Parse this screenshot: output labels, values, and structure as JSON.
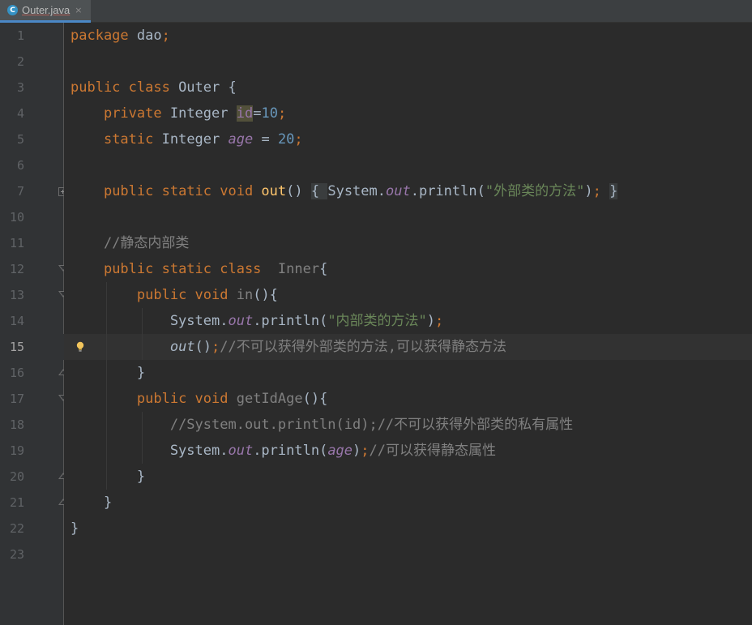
{
  "tab": {
    "icon_letter": "C",
    "label": "Outer.java",
    "close": "×"
  },
  "current_line": "15",
  "lines": [
    {
      "num": "1",
      "segments": [
        [
          "kw",
          "package "
        ],
        [
          "pl",
          "dao"
        ],
        [
          "kw",
          ";"
        ]
      ]
    },
    {
      "num": "2",
      "segments": []
    },
    {
      "num": "3",
      "segments": [
        [
          "kw",
          "public class "
        ],
        [
          "pl",
          "Outer {"
        ]
      ]
    },
    {
      "num": "4",
      "segments": [
        [
          "pl",
          "    "
        ],
        [
          "kw",
          "private "
        ],
        [
          "pl",
          "Integer "
        ],
        [
          "field",
          "id"
        ],
        [
          "pl",
          "="
        ],
        [
          "num",
          "10"
        ],
        [
          "kw",
          ";"
        ]
      ]
    },
    {
      "num": "5",
      "segments": [
        [
          "pl",
          "    "
        ],
        [
          "kw",
          "static "
        ],
        [
          "pl",
          "Integer "
        ],
        [
          "ifield",
          "age"
        ],
        [
          "pl",
          " = "
        ],
        [
          "num",
          "20"
        ],
        [
          "kw",
          ";"
        ]
      ]
    },
    {
      "num": "6",
      "segments": []
    },
    {
      "num": "7",
      "segments": [
        [
          "pl",
          "    "
        ],
        [
          "kw",
          "public static void "
        ],
        [
          "fn",
          "out"
        ],
        [
          "pl",
          "() "
        ],
        [
          "fold",
          "{ "
        ],
        [
          "pl",
          "System."
        ],
        [
          "ifield",
          "out"
        ],
        [
          "pl",
          ".println("
        ],
        [
          "str",
          "\"外部类的方法\""
        ],
        [
          "pl",
          ")"
        ],
        [
          "kw",
          ";"
        ],
        [
          "pl",
          " "
        ],
        [
          "fold",
          "}"
        ]
      ]
    },
    {
      "num": "10",
      "segments": []
    },
    {
      "num": "11",
      "segments": [
        [
          "pl",
          "    "
        ],
        [
          "cmt",
          "//静态内部类"
        ]
      ]
    },
    {
      "num": "12",
      "segments": [
        [
          "pl",
          "    "
        ],
        [
          "kw",
          "public static class  "
        ],
        [
          "gray",
          "Inner"
        ],
        [
          "pl",
          "{"
        ]
      ]
    },
    {
      "num": "13",
      "segments": [
        [
          "pl",
          "        "
        ],
        [
          "kw",
          "public void "
        ],
        [
          "gray",
          "in"
        ],
        [
          "pl",
          "(){"
        ]
      ]
    },
    {
      "num": "14",
      "segments": [
        [
          "pl",
          "            System."
        ],
        [
          "ifield",
          "out"
        ],
        [
          "pl",
          ".println("
        ],
        [
          "str",
          "\"内部类的方法\""
        ],
        [
          "pl",
          ")"
        ],
        [
          "kw",
          ";"
        ]
      ]
    },
    {
      "num": "15",
      "segments": [
        [
          "pl",
          "            "
        ],
        [
          "sstat",
          "out"
        ],
        [
          "pl",
          "()"
        ],
        [
          "kw",
          ";"
        ],
        [
          "cmt",
          "//不可以获得外部类的方法,可以获得静态方法"
        ]
      ]
    },
    {
      "num": "16",
      "segments": [
        [
          "pl",
          "        }"
        ]
      ]
    },
    {
      "num": "17",
      "segments": [
        [
          "pl",
          "        "
        ],
        [
          "kw",
          "public void "
        ],
        [
          "gray",
          "getIdAge"
        ],
        [
          "pl",
          "(){"
        ]
      ]
    },
    {
      "num": "18",
      "segments": [
        [
          "pl",
          "            "
        ],
        [
          "cmt",
          "//System.out.println(id);//不可以获得外部类的私有属性"
        ]
      ]
    },
    {
      "num": "19",
      "segments": [
        [
          "pl",
          "            System."
        ],
        [
          "ifield",
          "out"
        ],
        [
          "pl",
          ".println("
        ],
        [
          "ifield",
          "age"
        ],
        [
          "pl",
          ")"
        ],
        [
          "kw",
          ";"
        ],
        [
          "cmt",
          "//可以获得静态属性"
        ]
      ]
    },
    {
      "num": "20",
      "segments": [
        [
          "pl",
          "        }"
        ]
      ]
    },
    {
      "num": "21",
      "segments": [
        [
          "pl",
          "    }"
        ]
      ]
    },
    {
      "num": "22",
      "segments": [
        [
          "pl",
          "}"
        ]
      ]
    },
    {
      "num": "23",
      "segments": []
    }
  ],
  "colors": {
    "background": "#2b2b2b",
    "keyword": "#cc7832",
    "string": "#6a8759",
    "number": "#6897bb",
    "field": "#9876aa",
    "method": "#ffc66d",
    "comment": "#808080"
  },
  "icons": {
    "tab": "java-class-icon",
    "bulb": "lightbulb-icon"
  }
}
